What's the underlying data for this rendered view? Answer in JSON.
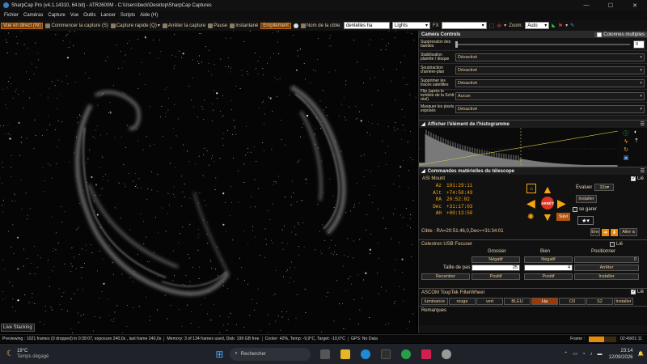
{
  "window": {
    "title": "SharpCap Pro (v4.1.14310, 64 bit) - ATR2600M - C:\\Users\\beck\\Desktop\\SharpCap Captures"
  },
  "menu": [
    "Fichier",
    "Caméras",
    "Capture",
    "Vue",
    "Outils",
    "Lancer",
    "Scripts",
    "Aide (H)"
  ],
  "toolbar": {
    "live_view": "Vue en direct (W)",
    "start_capture": "Commencer la capture (S)",
    "quick_capture": "Capture rapide (Q)",
    "stop_capture": "Arrêter la capture",
    "pause": "Pause",
    "snapshot": "Instantané",
    "stacking": "Empilement",
    "target_label": "Nom de la cible:",
    "target_value": "dentelles ha",
    "frame_type": "Lights",
    "fx_label": "FX",
    "zoom_label": "Zoom:",
    "zoom_value": "Auto"
  },
  "camera_controls": {
    "header": "Camera Controls",
    "multi_columns": "Colonnes multiples",
    "rows": [
      {
        "label": "Suppression des bandes",
        "value": "0"
      },
      {
        "label": "Stabilisation planète / disque",
        "value": "Désactivé"
      },
      {
        "label": "Soustraction d'arrière-plan",
        "value": "Désactivé"
      },
      {
        "label": "Supprimer les traces satellites",
        "value": "Désactivé"
      },
      {
        "label": "Flip (après le tombée de la Schlt réel)",
        "value": "Aucun"
      },
      {
        "label": "Masquer les pixels exposés",
        "value": "Désactivé"
      }
    ]
  },
  "histogram": {
    "title": "Afficher l'élément de l'histogramme"
  },
  "telescope": {
    "title": "Commandes matérielles du télescope",
    "mount": "ASI Mount",
    "linked": "Lié",
    "coords": [
      {
        "k": "Az",
        "v": "191:29:11"
      },
      {
        "k": "Alt",
        "v": "+74:58:49"
      },
      {
        "k": "RA",
        "v": "20:52:02"
      },
      {
        "k": "Déc",
        "v": "+31:17:03"
      },
      {
        "k": "AH",
        "v": "+00:13:50"
      }
    ],
    "rate_label": "Évaluer",
    "rate_value": "32x",
    "install": "Installer",
    "park": "se garer",
    "stop": "ARRÊT",
    "follow": "Suivi",
    "target": "Cible : RA=20:51:46,0,Dec=+31:34:01",
    "goto": "Aller à",
    "env": "Env"
  },
  "focuser": {
    "title": "Celestron USB Focuser",
    "linked": "Lié",
    "cols": [
      "Grossier",
      "Bien",
      "Positionner"
    ],
    "negative": "Négatif",
    "positive": "Positif",
    "step_label": "Taille de pas",
    "coarse_step": "25",
    "fine_step": "4",
    "position": "0",
    "stop": "Arrêter",
    "recenter": "Recentrer",
    "install": "Installer"
  },
  "filterwheel": {
    "title": "ASCOM ToupTek FilterWheel",
    "linked": "Lié",
    "filters": [
      "luminance",
      "rouge",
      "vert",
      "BLEU",
      "Ha",
      "O3",
      "S2"
    ],
    "selected": "Ha",
    "install": "Installer"
  },
  "remarks": {
    "label": "Remarques"
  },
  "live_stacking": "Live Stacking",
  "status": {
    "preview": "Previewing : 1021 frames (0 dropped) in 0:39:07, exposure 240,0s , last frame 240,0s",
    "memory": "Memory: 3 of 134 frames used, Disk: 199 GB free",
    "cooler": "Cooler: 42%, Temp: -9,9°C, Target: -10,0°C",
    "gps": "GPS: No Data",
    "frame_label": "Frame :",
    "frame_time": "02:49/01:11",
    "frame_progress": 0.55
  },
  "taskbar": {
    "temp": "19°C",
    "weather": "Temps dégagé",
    "search": "Rechercher",
    "time": "23:14",
    "date": "12/09/2026"
  }
}
